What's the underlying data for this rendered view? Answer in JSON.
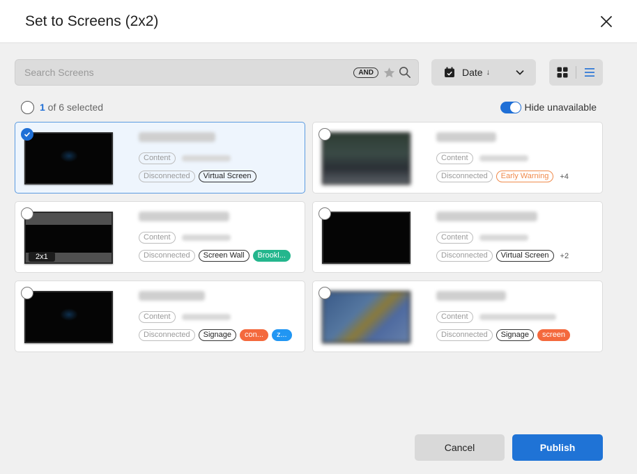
{
  "dialog": {
    "title": "Set to Screens (2x2)"
  },
  "toolbar": {
    "search_placeholder": "Search Screens",
    "and_label": "AND",
    "sort_label": "Date",
    "sort_arrow": "↓"
  },
  "selection": {
    "count": "1",
    "rest": " of 6 selected",
    "hide_label": "Hide unavailable"
  },
  "cards": [
    {
      "selected": true,
      "tags": [
        "Content",
        "Disconnected",
        "Virtual Screen"
      ]
    },
    {
      "selected": false,
      "tags": [
        "Content",
        "Disconnected",
        "Early Warning"
      ],
      "more": "+4"
    },
    {
      "selected": false,
      "badge": "2x1",
      "tags": [
        "Content",
        "Disconnected",
        "Screen Wall",
        "Brookl..."
      ]
    },
    {
      "selected": false,
      "tags": [
        "Content",
        "Disconnected",
        "Virtual Screen"
      ],
      "more": "+2"
    },
    {
      "selected": false,
      "tags": [
        "Content",
        "Disconnected",
        "Signage",
        "con...",
        "z..."
      ]
    },
    {
      "selected": false,
      "tags": [
        "Content",
        "Disconnected",
        "Signage",
        "screen"
      ]
    }
  ],
  "colors": {
    "accent": "#1f6fd6",
    "green": "#24b68d",
    "orange": "#f4693d",
    "blue": "#2196f3",
    "warning": "#f08a4b"
  },
  "footer": {
    "cancel_label": "Cancel",
    "publish_label": "Publish"
  }
}
